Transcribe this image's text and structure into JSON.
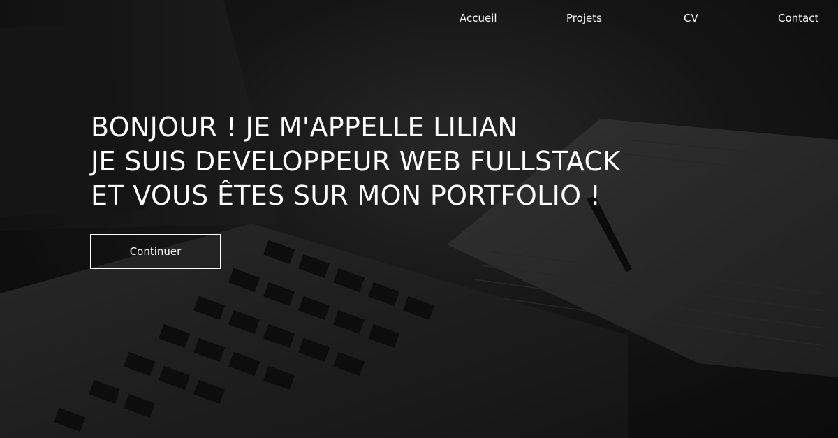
{
  "nav": {
    "items": [
      {
        "label": "Accueil"
      },
      {
        "label": "Projets"
      },
      {
        "label": "CV"
      },
      {
        "label": "Contact"
      }
    ]
  },
  "hero": {
    "lines": [
      "BONJOUR ! JE M'APPELLE LILIAN",
      "JE SUIS DEVELOPPEUR WEB FULLSTACK",
      "ET VOUS ÊTES SUR MON PORTFOLIO !"
    ],
    "cta_label": "Continuer"
  },
  "colors": {
    "text": "#ffffff",
    "background": "#1a1a1a"
  }
}
